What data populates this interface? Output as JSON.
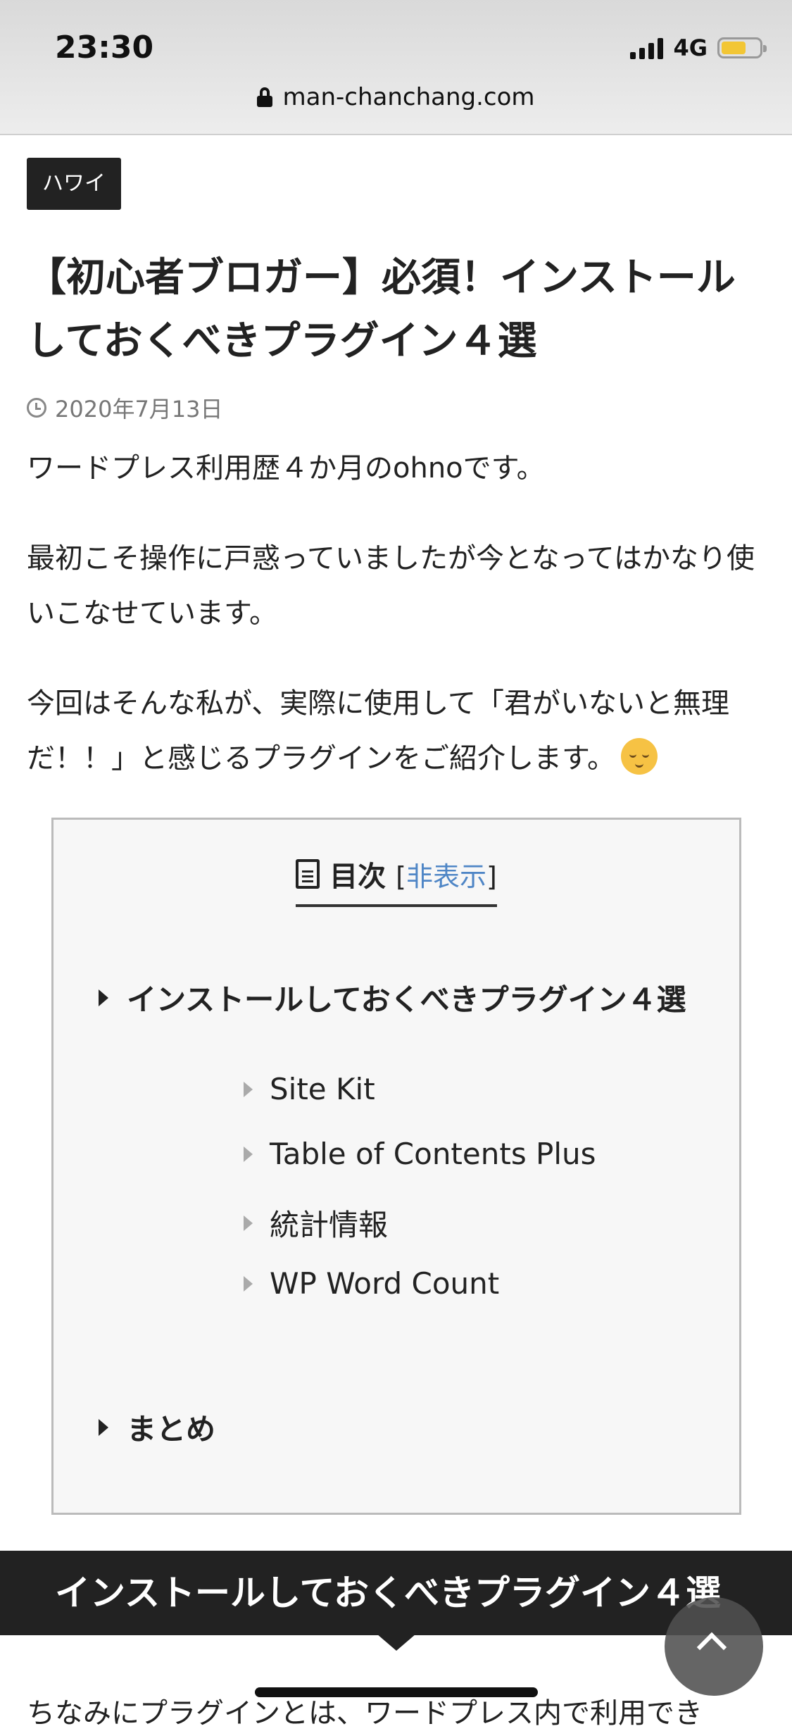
{
  "status_bar": {
    "time": "23:30",
    "network": "4G"
  },
  "browser": {
    "url": "man-chanchang.com"
  },
  "article": {
    "category": "ハワイ",
    "title": "【初心者ブロガー】必須！インストールしておくべきプラグイン４選",
    "date": "2020年7月13日",
    "paragraphs": [
      "ワードプレス利用歴４か月のohnoです。",
      "最初こそ操作に戸惑っていましたが今となってはかなり使いこなせています。",
      "今回はそんな私が、実際に使用して「君がいないと無理だ！！」と感じるプラグインをご紹介します。"
    ]
  },
  "toc": {
    "title": "目次",
    "toggle_open": "[",
    "toggle_label": "非表示",
    "toggle_close": "]",
    "items": [
      {
        "label": "インストールしておくべきプラグイン４選",
        "level": 1
      },
      {
        "label": "Site Kit",
        "level": 2
      },
      {
        "label": "Table of Contents Plus",
        "level": 2
      },
      {
        "label": "統計情報",
        "level": 2
      },
      {
        "label": "WP Word Count",
        "level": 2
      },
      {
        "label": "まとめ",
        "level": 1
      }
    ]
  },
  "section_heading": "インストールしておくべきプラグイン４選",
  "next_text": "ちなみにプラグインとは、ワードプレス内で利用でき",
  "icons": {
    "lock": "lock-icon",
    "clock": "clock-icon",
    "document": "document-icon",
    "emoji": "relieved-face-emoji",
    "scroll_top": "chevron-up-icon"
  },
  "colors": {
    "badge_bg": "#222222",
    "link": "#4f86c6",
    "battery": "#f2c635"
  }
}
